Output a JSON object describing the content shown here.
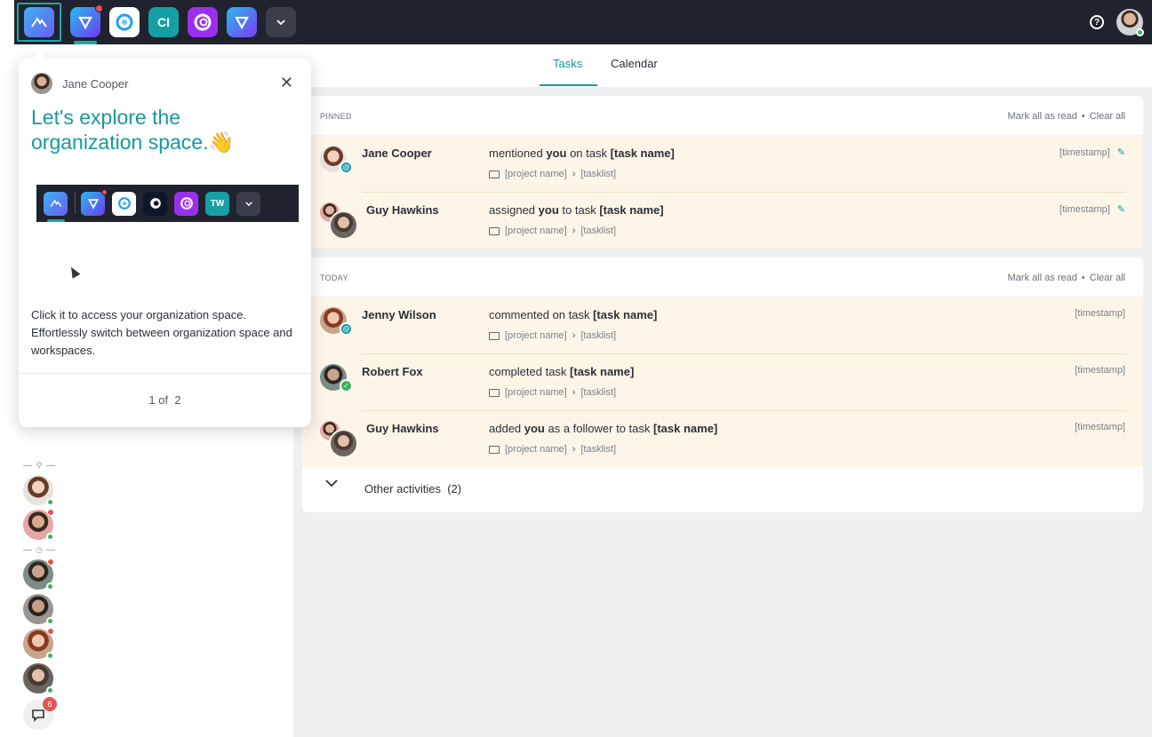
{
  "topbar": {
    "apps": [
      {
        "name": "organization-space",
        "label": ""
      },
      {
        "name": "workspace-v",
        "label": ""
      },
      {
        "name": "workspace-swirl",
        "label": ""
      },
      {
        "name": "workspace-ci",
        "label": "CI"
      },
      {
        "name": "workspace-chain",
        "label": ""
      },
      {
        "name": "workspace-v2",
        "label": ""
      }
    ],
    "help_symbol": "?"
  },
  "sidebar": {
    "chat_badge": "6"
  },
  "tabs": [
    {
      "label": "Tasks",
      "active": true
    },
    {
      "label": "Calendar",
      "active": false
    }
  ],
  "pinned": {
    "title": "PINNED",
    "mark_all": "Mark all as read",
    "clear_all": "Clear all",
    "rows": [
      {
        "name": "Jane Cooper",
        "pre": "mentioned ",
        "you": "you",
        "mid": " on task ",
        "task": "[task name]",
        "post": "",
        "project": "[project name]",
        "tasklist": "[tasklist]",
        "time": "[timestamp]"
      },
      {
        "name": "Guy Hawkins",
        "pre": "assigned ",
        "you": "you",
        "mid": " to task ",
        "task": "[task name]",
        "post": "",
        "project": "[project name]",
        "tasklist": "[tasklist]",
        "time": "[timestamp]"
      }
    ]
  },
  "today": {
    "title": "TODAY",
    "mark_all": "Mark all as read",
    "clear_all": "Clear all",
    "rows": [
      {
        "name": "Jenny Wilson",
        "pre": "commented on task ",
        "task": "[task name]",
        "project": "[project name]",
        "tasklist": "[tasklist]",
        "time": "[timestamp]"
      },
      {
        "name": "Robert Fox",
        "pre": "completed task ",
        "task": "[task name]",
        "project": "[project name]",
        "tasklist": "[tasklist]",
        "time": "[timestamp]"
      },
      {
        "name": "Guy Hawkins",
        "pre": "added ",
        "you": "you",
        "mid": " as a follower to task ",
        "task": "[task name]",
        "project": "[project name]",
        "tasklist": "[tasklist]",
        "time": "[timestamp]"
      }
    ],
    "other_label": "Other activities  (2)"
  },
  "popover": {
    "author": "Jane Cooper",
    "title": "Let's explore the organization space.👋",
    "preview_tw": "TW",
    "body": "Click it to access your organization space. Effortlessly switch between organization space and workspaces.",
    "step": "1 of  2"
  },
  "colors": {
    "accent": "#17999e",
    "topbar": "#20232d",
    "row_highlight": "#fdf6e8",
    "online": "#3bb55c",
    "alert": "#e55353"
  }
}
